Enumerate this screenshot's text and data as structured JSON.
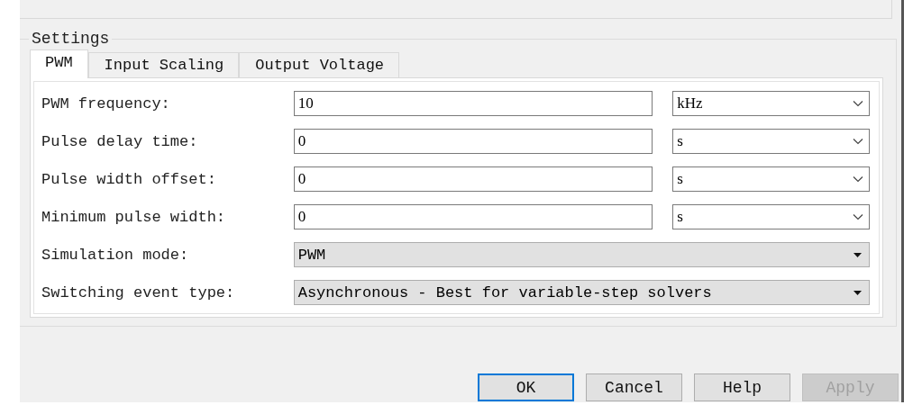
{
  "settings": {
    "title": "Settings",
    "tabs": [
      {
        "label": "PWM",
        "selected": true
      },
      {
        "label": "Input Scaling",
        "selected": false
      },
      {
        "label": "Output Voltage",
        "selected": false
      }
    ],
    "rows": [
      {
        "kind": "value_unit",
        "label": "PWM frequency:",
        "value": "10",
        "unit": "kHz"
      },
      {
        "kind": "value_unit",
        "label": "Pulse delay time:",
        "value": "0",
        "unit": "s"
      },
      {
        "kind": "value_unit",
        "label": "Pulse width offset:",
        "value": "0",
        "unit": "s"
      },
      {
        "kind": "value_unit",
        "label": "Minimum pulse width:",
        "value": "0",
        "unit": "s"
      },
      {
        "kind": "dropdown",
        "label": "Simulation mode:",
        "value": "PWM"
      },
      {
        "kind": "dropdown",
        "label": "Switching event type:",
        "value": "Asynchronous - Best for variable-step solvers"
      }
    ]
  },
  "buttons": [
    {
      "label": "OK",
      "default": true,
      "disabled": false
    },
    {
      "label": "Cancel",
      "default": false,
      "disabled": false
    },
    {
      "label": "Help",
      "default": false,
      "disabled": false
    },
    {
      "label": "Apply",
      "default": false,
      "disabled": true
    }
  ]
}
